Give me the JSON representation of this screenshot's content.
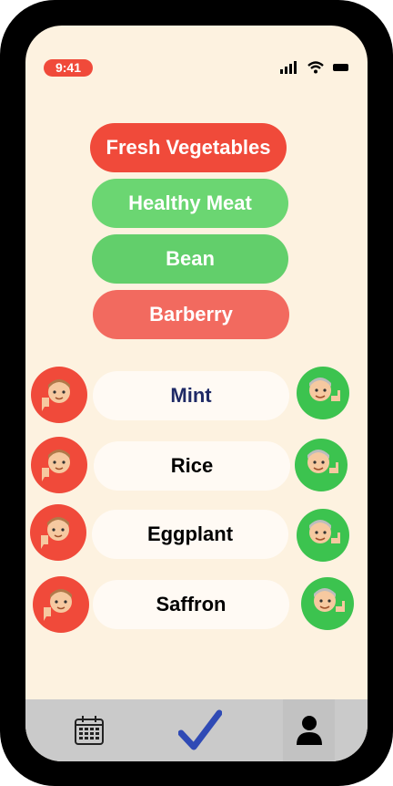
{
  "status": {
    "time": "9:41"
  },
  "categories": [
    {
      "label": "Fresh Vegetables",
      "color": "#f04a3a"
    },
    {
      "label": "Healthy Meat",
      "color": "#6bd672"
    },
    {
      "label": "Bean",
      "color": "#62cf6b"
    },
    {
      "label": "Barberry",
      "color": "#f26a5f"
    }
  ],
  "items": [
    {
      "label": "Mint",
      "color": "#1f2a66"
    },
    {
      "label": "Rice",
      "color": "#000000"
    },
    {
      "label": "Eggplant",
      "color": "#000000"
    },
    {
      "label": "Saffron",
      "color": "#000000"
    }
  ],
  "tabbar": {
    "icons": [
      "calendar-icon",
      "checkmark-icon",
      "profile-icon"
    ]
  },
  "colors": {
    "background": "#fdf2e0",
    "dislike": "#f04a3a",
    "like": "#3cc34f",
    "check": "#2f4ab5"
  }
}
